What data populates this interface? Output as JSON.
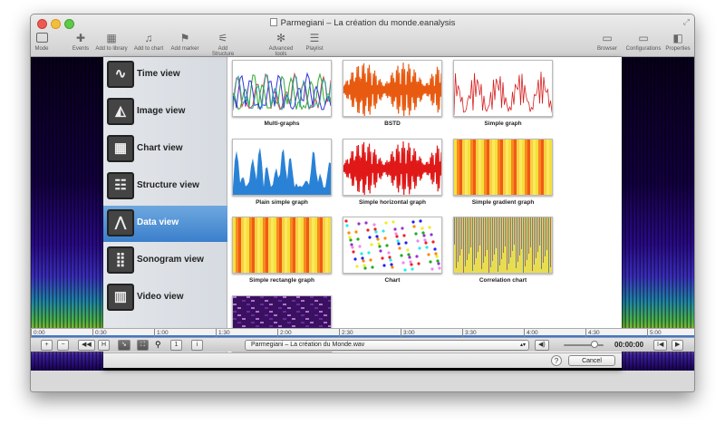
{
  "window": {
    "title": "Parmegiani – La création du monde.eanalysis"
  },
  "toolbar": {
    "mode": "Mode",
    "events": "Events",
    "add_to_library": "Add to library",
    "add_to_chart": "Add to chart",
    "add_marker": "Add marker",
    "add_structure": "Add Structure",
    "advanced_tools": "Advanced tools",
    "playlist": "Playlist",
    "browser": "Browser",
    "configurations": "Configurations",
    "properties": "Properties"
  },
  "sidebar": {
    "items": [
      {
        "label": "Time view",
        "icon": "waveform-icon"
      },
      {
        "label": "Image view",
        "icon": "image-icon"
      },
      {
        "label": "Chart view",
        "icon": "chart-layout-icon"
      },
      {
        "label": "Structure view",
        "icon": "structure-icon"
      },
      {
        "label": "Data view",
        "icon": "data-graph-icon",
        "selected": true
      },
      {
        "label": "Sonogram view",
        "icon": "sonogram-icon"
      },
      {
        "label": "Video view",
        "icon": "film-icon"
      }
    ]
  },
  "views": [
    {
      "caption": "Multi-graphs"
    },
    {
      "caption": "BSTD"
    },
    {
      "caption": "Simple graph"
    },
    {
      "caption": "Plain simple graph"
    },
    {
      "caption": "Simple horizontal graph"
    },
    {
      "caption": "Simple gradient graph"
    },
    {
      "caption": "Simple rectangle graph"
    },
    {
      "caption": "Chart"
    },
    {
      "caption": "Correlation chart"
    },
    {
      "caption": ""
    }
  ],
  "dialog": {
    "help": "?",
    "cancel": "Cancel"
  },
  "ruler": {
    "ticks": [
      "0:00",
      "0:30",
      "1:00",
      "1:30",
      "2:00",
      "2:30",
      "3:00",
      "3:30",
      "4:00",
      "4:30",
      "5:00"
    ]
  },
  "bottombar": {
    "add": "+",
    "remove": "−",
    "rewind": "◀◀",
    "h_button": "H",
    "page_number": "1",
    "info": "i",
    "file": "Parmegiani – La création du Monde.wav",
    "time": "00:00:00"
  }
}
